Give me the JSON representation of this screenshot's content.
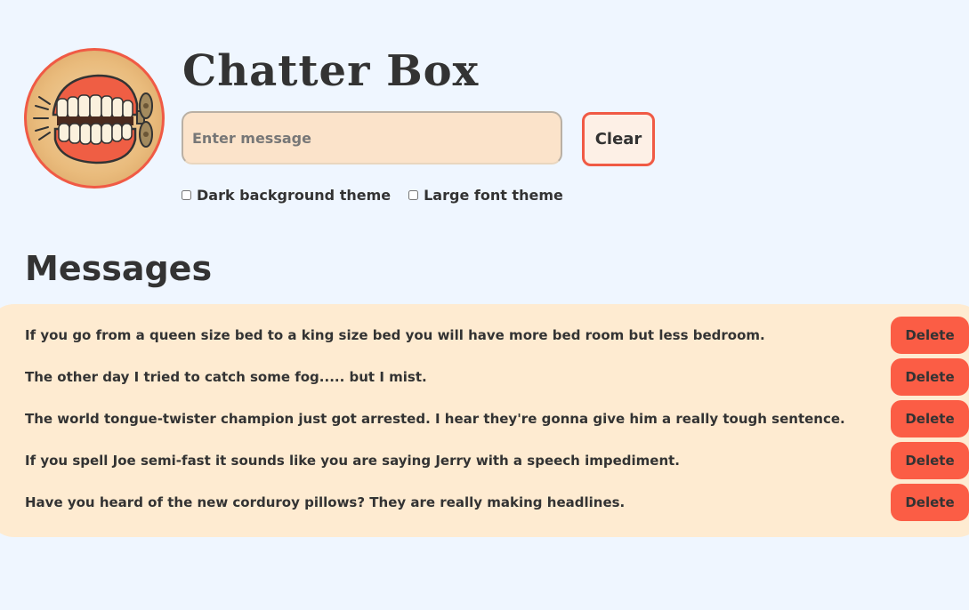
{
  "header": {
    "title": "Chatter Box"
  },
  "composer": {
    "placeholder": "Enter message",
    "value": "",
    "clear_label": "Clear"
  },
  "themes": {
    "dark_label": "Dark background theme",
    "dark_checked": false,
    "large_label": "Large font theme",
    "large_checked": false
  },
  "messages": {
    "heading": "Messages",
    "delete_label": "Delete",
    "items": [
      {
        "text": "If you go from a queen size bed to a king size bed you will have more bed room but less bedroom."
      },
      {
        "text": "The other day I tried to catch some fog..... but I mist."
      },
      {
        "text": "The world tongue-twister champion just got arrested. I hear they're gonna give him a really tough sentence."
      },
      {
        "text": "If you spell Joe semi-fast it sounds like you are saying Jerry with a speech impediment."
      },
      {
        "text": "Have you heard of the new corduroy pillows? They are really making headlines."
      }
    ]
  },
  "colors": {
    "page_background": "#eff6ff",
    "accent": "#f05a45",
    "delete_button": "#fb5d45",
    "list_background": "#feebd1",
    "input_background": "#fbe3ca"
  },
  "icons": {
    "logo": "wind-up-chattering-teeth-icon"
  }
}
